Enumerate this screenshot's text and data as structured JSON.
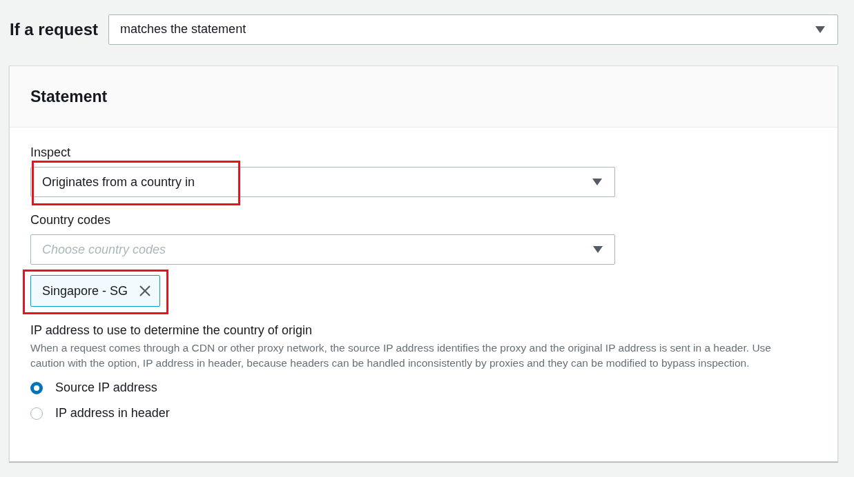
{
  "condition": {
    "label": "If a request",
    "value": "matches the statement"
  },
  "statement": {
    "title": "Statement",
    "inspect": {
      "label": "Inspect",
      "value": "Originates from a country in",
      "highlighted": true
    },
    "country_codes": {
      "label": "Country codes",
      "placeholder": "Choose country codes",
      "tokens": [
        {
          "label": "Singapore - SG",
          "highlighted": true
        }
      ]
    },
    "ip_source": {
      "label": "IP address to use to determine the country of origin",
      "description": "When a request comes through a CDN or other proxy network, the source IP address identifies the proxy and the original IP address is sent in a header. Use caution with the option, IP address in header, because headers can be handled inconsistently by proxies and they can be modified to bypass inspection.",
      "options": [
        {
          "label": "Source IP address",
          "selected": true
        },
        {
          "label": "IP address in header",
          "selected": false
        }
      ]
    }
  }
}
